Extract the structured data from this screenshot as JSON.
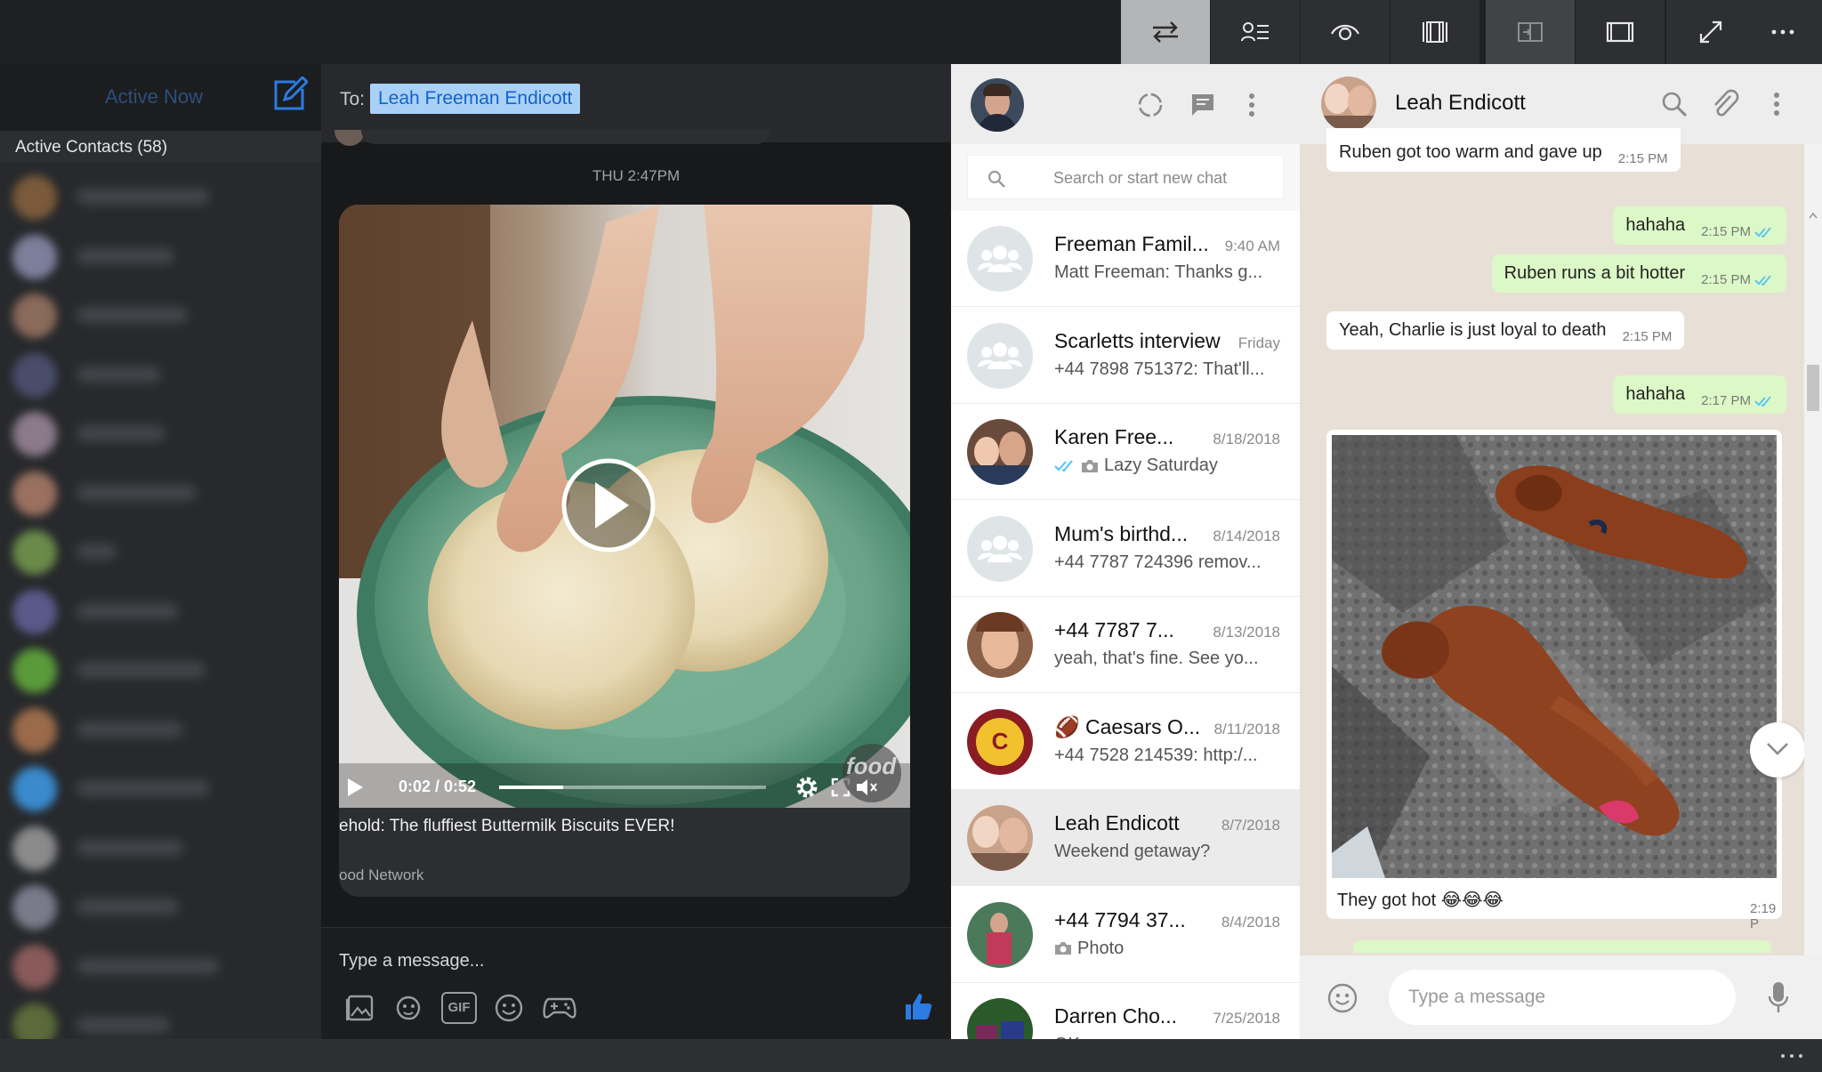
{
  "topbar": {
    "buttons": [
      "swap-panes-icon",
      "contact-list-icon",
      "eye-icon",
      "split-view-icon",
      "dock-right-icon",
      "single-pane-icon",
      "fullscreen-icon",
      "more-icon"
    ]
  },
  "messenger": {
    "active_now": "Active Now",
    "active_contacts": "Active Contacts (58)",
    "to_label": "To:",
    "to_recipient": "Leah Freeman Endicott",
    "timestamp": "THU 2:47PM",
    "video": {
      "time": "0:02 / 0:52",
      "progress": 0.04,
      "title": "ehold: The fluffiest Buttermilk Biscuits EVER!",
      "source": "ood Network",
      "watermark": "food"
    },
    "composer_placeholder": "Type a message...",
    "gif_label": "GIF"
  },
  "whatsapp_list": {
    "search_placeholder": "Search or start new chat",
    "chats": [
      {
        "name": "Freeman Famil...",
        "date": "9:40 AM",
        "preview": "Matt Freeman: Thanks g...",
        "avatar": "group"
      },
      {
        "name": "Scarletts interview",
        "date": "Friday",
        "preview": "+44 7898 751372: That'll...",
        "avatar": "group"
      },
      {
        "name": "Karen Free...",
        "date": "8/18/2018",
        "preview": "Lazy Saturday",
        "avatar": "photo1",
        "ticks": true,
        "camera": true
      },
      {
        "name": "Mum's birthd...",
        "date": "8/14/2018",
        "preview": "+44 7787 724396 remov...",
        "avatar": "group"
      },
      {
        "name": "+44 7787 7...",
        "date": "8/13/2018",
        "preview": "yeah, that's fine. See yo...",
        "avatar": "photo2"
      },
      {
        "name": "🏈 Caesars O...",
        "date": "8/11/2018",
        "preview": "+44 7528 214539: http:/...",
        "avatar": "caesars"
      },
      {
        "name": "Leah Endicott",
        "date": "8/7/2018",
        "preview": "Weekend getaway?",
        "avatar": "photo3",
        "selected": true
      },
      {
        "name": "+44 7794 37...",
        "date": "8/4/2018",
        "preview": "Photo",
        "avatar": "photo4",
        "camera": true
      },
      {
        "name": "Darren Cho...",
        "date": "7/25/2018",
        "preview": "OK ...",
        "avatar": "photo5"
      }
    ]
  },
  "whatsapp_conv": {
    "contact": "Leah Endicott",
    "messages": [
      {
        "dir": "in",
        "text": "Ruben got too warm and gave up",
        "time": "2:15 PM"
      },
      {
        "dir": "out",
        "text": "hahaha",
        "time": "2:15 PM"
      },
      {
        "dir": "out",
        "text": "Ruben runs a bit hotter",
        "time": "2:15 PM"
      },
      {
        "dir": "in",
        "text": "Yeah, Charlie is just loyal to death",
        "time": "2:15 PM"
      },
      {
        "dir": "out",
        "text": "hahaha",
        "time": "2:17 PM"
      }
    ],
    "photo_caption": "They got hot 😂😂😂",
    "photo_time": "2:19 P",
    "composer_placeholder": "Type a message"
  }
}
